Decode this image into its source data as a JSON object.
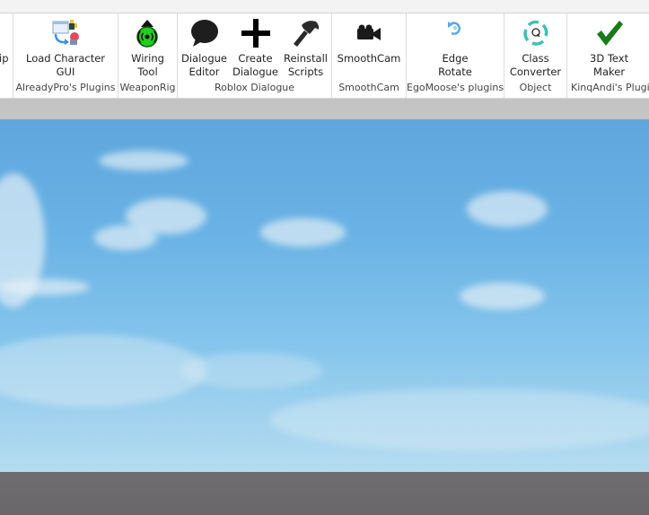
{
  "ribbon": {
    "groups": [
      {
        "label": "",
        "buttons": [
          {
            "label": "ip",
            "icon": "truncated"
          }
        ]
      },
      {
        "label": "AlreadyPro's Plugins",
        "buttons": [
          {
            "label": "Load Character\nGUI",
            "icon": "load-character-icon"
          }
        ]
      },
      {
        "label": "WeaponRig",
        "buttons": [
          {
            "label": "Wiring\nTool",
            "icon": "wiring-tool-icon"
          }
        ]
      },
      {
        "label": "Roblox Dialogue",
        "buttons": [
          {
            "label": "Dialogue\nEditor",
            "icon": "speech-bubble-icon"
          },
          {
            "label": "Create\nDialogue",
            "icon": "plus-icon"
          },
          {
            "label": "Reinstall\nScripts",
            "icon": "hammer-icon"
          }
        ]
      },
      {
        "label": "SmoothCam",
        "buttons": [
          {
            "label": "SmoothCam",
            "icon": "video-camera-icon"
          }
        ]
      },
      {
        "label": "EgoMoose's plugins",
        "buttons": [
          {
            "label": "Edge\nRotate",
            "icon": "rotate-icon"
          }
        ]
      },
      {
        "label": "Object",
        "buttons": [
          {
            "label": "Class\nConverter",
            "icon": "class-converter-icon"
          }
        ]
      },
      {
        "label": "KinqAndi's Plugin",
        "buttons": [
          {
            "label": "3D Text\nMaker",
            "icon": "checkmark-icon"
          }
        ]
      }
    ]
  },
  "colors": {
    "wiring_green": "#22cc22",
    "checkmark_green": "#1a7a1a",
    "class_converter_teal": "#3ec1b4",
    "rotate_blue": "#5aa8e6",
    "sky_top": "#5ea6dc",
    "sky_horizon": "#b6dcf0",
    "baseplate": "#6f6c70"
  }
}
